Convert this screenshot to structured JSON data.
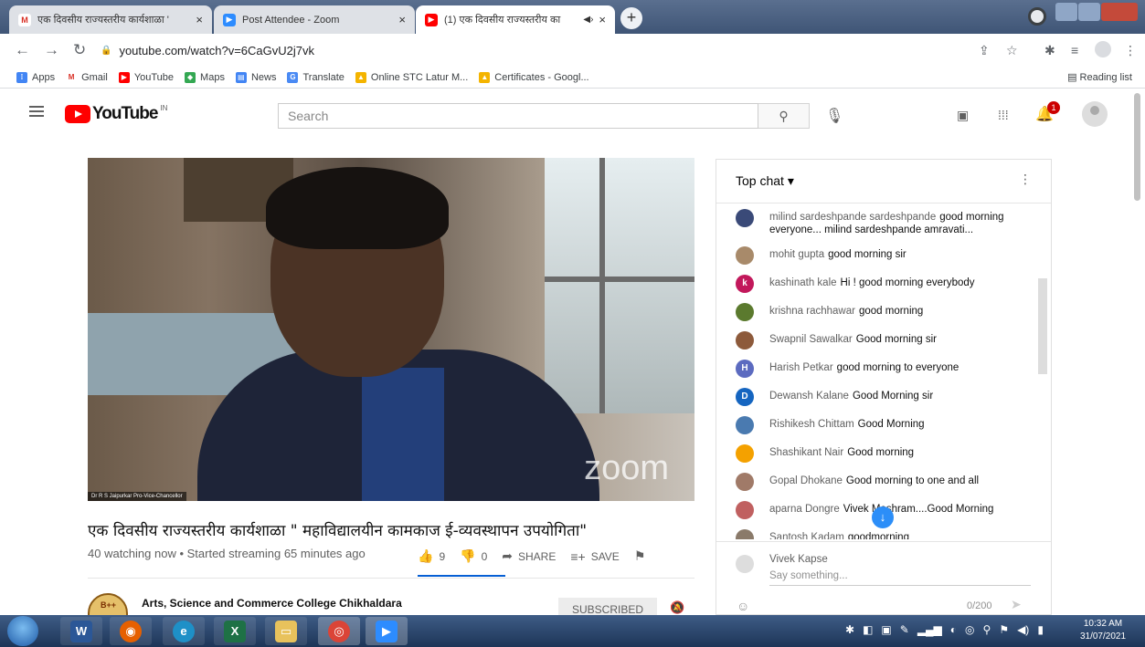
{
  "browser": {
    "tabs": [
      {
        "title": "एक दिवसीय राज्यस्तरीय कार्यशाळा ' ",
        "close": "×"
      },
      {
        "title": "Post Attendee - Zoom",
        "close": "×"
      },
      {
        "title": "(1) एक दिवसीय राज्यस्तरीय का",
        "close": "×",
        "audio": "◀›"
      }
    ],
    "new_tab": "+",
    "url": "youtube.com/watch?v=6CaGvU2j7vk",
    "bookmarks": [
      "Apps",
      "Gmail",
      "YouTube",
      "Maps",
      "News",
      "Translate",
      "Online STC Latur M...",
      "Certificates - Googl..."
    ],
    "reading_list": "Reading list"
  },
  "youtube": {
    "logo_text": "YouTube",
    "country": "IN",
    "search_placeholder": "Search",
    "notification_count": "1"
  },
  "video": {
    "zoom_watermark": "zoom",
    "name_tag": "Dr R S Jaipurkar Pro-Vice-Chancellor",
    "title": "एक दिवसीय राज्यस्तरीय कार्यशाळा \" महाविद्यालयीन कामकाज ई-व्यवस्थापन उपयोगिता\"",
    "meta": "40 watching now • Started streaming 65 minutes ago",
    "likes": "9",
    "dislikes": "0",
    "share": "SHARE",
    "save": "SAVE",
    "channel_badge": "B++",
    "channel_name": "Arts, Science and Commerce College Chikhaldara",
    "subscribe": "SUBSCRIBED"
  },
  "chat": {
    "header": "Top chat ▾",
    "messages": [
      {
        "author": "milind sardeshpande sardeshpande",
        "text": "good morning everyone... milind sardeshpande amravati...",
        "initial": "",
        "color": "#3a4a78"
      },
      {
        "author": "mohit gupta",
        "text": "good morning sir",
        "initial": "",
        "color": "#a88a6a"
      },
      {
        "author": "kashinath kale",
        "text": "Hi ! good morning everybody",
        "initial": "k",
        "color": "#c2185b"
      },
      {
        "author": "krishna rachhawar",
        "text": "good morning",
        "initial": "",
        "color": "#5b7a2e"
      },
      {
        "author": "Swapnil Sawalkar",
        "text": "Good morning sir",
        "initial": "",
        "color": "#8d5a3b"
      },
      {
        "author": "Harish Petkar",
        "text": "good morning to everyone",
        "initial": "H",
        "color": "#5c6bc0"
      },
      {
        "author": "Dewansh Kalane",
        "text": "Good Morning sir",
        "initial": "D",
        "color": "#1565c0"
      },
      {
        "author": "Rishikesh Chittam",
        "text": "Good Morning",
        "initial": "",
        "color": "#4a7ab0"
      },
      {
        "author": "Shashikant Nair",
        "text": "Good morning",
        "initial": "",
        "color": "#f4a100"
      },
      {
        "author": "Gopal Dhokane",
        "text": "Good morning to one and all",
        "initial": "",
        "color": "#a07a68"
      },
      {
        "author": "aparna Dongre",
        "text": "Vivek Meshram....Good Morning",
        "initial": "",
        "color": "#c06060"
      },
      {
        "author": "Santosh Kadam",
        "text": "goodmorning",
        "initial": "",
        "color": "#8a7a6a"
      }
    ],
    "input_user": "Vivek Kapse",
    "input_placeholder": "Say something...",
    "char_count": "0/200"
  },
  "taskbar": {
    "time": "10:32 AM",
    "date": "31/07/2021"
  }
}
